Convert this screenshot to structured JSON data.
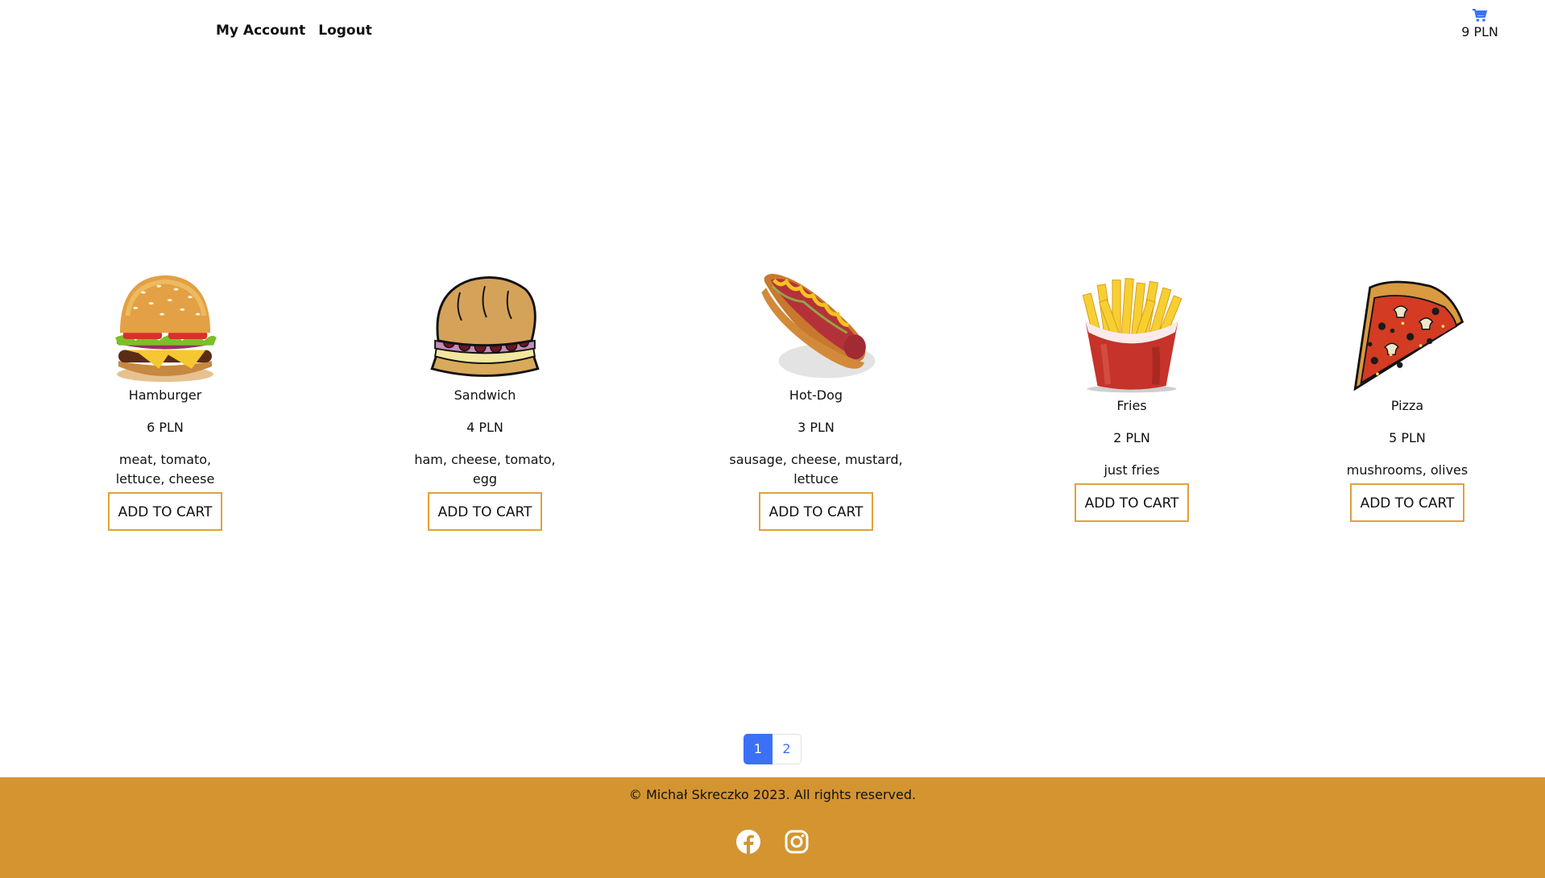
{
  "nav": {
    "my_account": "My Account",
    "logout": "Logout"
  },
  "cart": {
    "icon": "cart-icon",
    "total": "9 PLN",
    "accent": "#3b71f7"
  },
  "products": [
    {
      "name": "Hamburger",
      "price": "6 PLN",
      "description": "meat, tomato, lettuce, cheese",
      "button": "ADD TO CART",
      "image": "hamburger-image"
    },
    {
      "name": "Sandwich",
      "price": "4 PLN",
      "description": "ham, cheese, tomato, egg",
      "button": "ADD TO CART",
      "image": "sandwich-image"
    },
    {
      "name": "Hot-Dog",
      "price": "3 PLN",
      "description": "sausage, cheese, mustard, lettuce",
      "button": "ADD TO CART",
      "image": "hotdog-image"
    },
    {
      "name": "Fries",
      "price": "2 PLN",
      "description": "just fries",
      "button": "ADD TO CART",
      "image": "fries-image"
    },
    {
      "name": "Pizza",
      "price": "5 PLN",
      "description": "mushrooms, olives",
      "button": "ADD TO CART",
      "image": "pizza-image"
    }
  ],
  "pagination": {
    "pages": [
      "1",
      "2"
    ],
    "current": "1"
  },
  "footer": {
    "copyright": "© Michał Skreczko 2023. All rights reserved.",
    "social": [
      "facebook-icon",
      "instagram-icon"
    ],
    "background": "#d49430"
  },
  "colors": {
    "button_border": "#e1a13a",
    "pagination_active": "#3b71f7"
  }
}
